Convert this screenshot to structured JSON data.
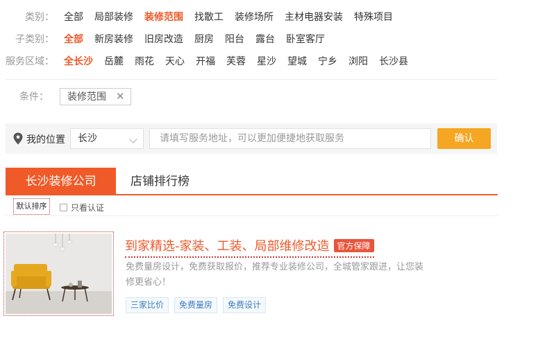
{
  "filters": {
    "category": {
      "label": "类别：",
      "options": [
        "全部",
        "局部装修",
        "装修范围",
        "找散工",
        "装修场所",
        "主材电器安装",
        "特殊项目"
      ],
      "active": 2
    },
    "subcategory": {
      "label": "子类别：",
      "options": [
        "全部",
        "新房装修",
        "旧房改造",
        "厨房",
        "阳台",
        "露台",
        "卧室客厅"
      ],
      "active": 0
    },
    "area": {
      "label": "服务区域：",
      "options": [
        "全长沙",
        "岳麓",
        "雨花",
        "天心",
        "开福",
        "芙蓉",
        "星沙",
        "望城",
        "宁乡",
        "浏阳",
        "长沙县"
      ],
      "active": 0
    }
  },
  "conditions": {
    "label": "条件：",
    "tag": "装修范围",
    "remove_glyph": "✕"
  },
  "location": {
    "label": "我的位置",
    "city": "长沙",
    "address_placeholder": "请填写服务地址，可以更加便捷地获取服务",
    "confirm": "确认"
  },
  "tabs": {
    "active": "长沙装修公司",
    "other": "店铺排行榜"
  },
  "sort": {
    "default": "默认排序",
    "verified_only": "只看认证"
  },
  "listing": {
    "title": "到家精选-家装、工装、局部维修改造",
    "badge": "官方保障",
    "description": "免费量房设计，免费获取报价，推荐专业装修公司，全城管家跟进，让您装修更省心！",
    "tags": [
      "三家比价",
      "免费量房",
      "免费设计"
    ]
  },
  "colors": {
    "accent": "#f05a28",
    "confirm": "#f5a623",
    "badge": "#e8553b",
    "tag_text": "#3d7bbf"
  },
  "icons": {
    "location": "map-pin-icon",
    "dropdown": "chevron-down-icon",
    "remove": "close-icon",
    "checkbox": "checkbox-icon"
  }
}
